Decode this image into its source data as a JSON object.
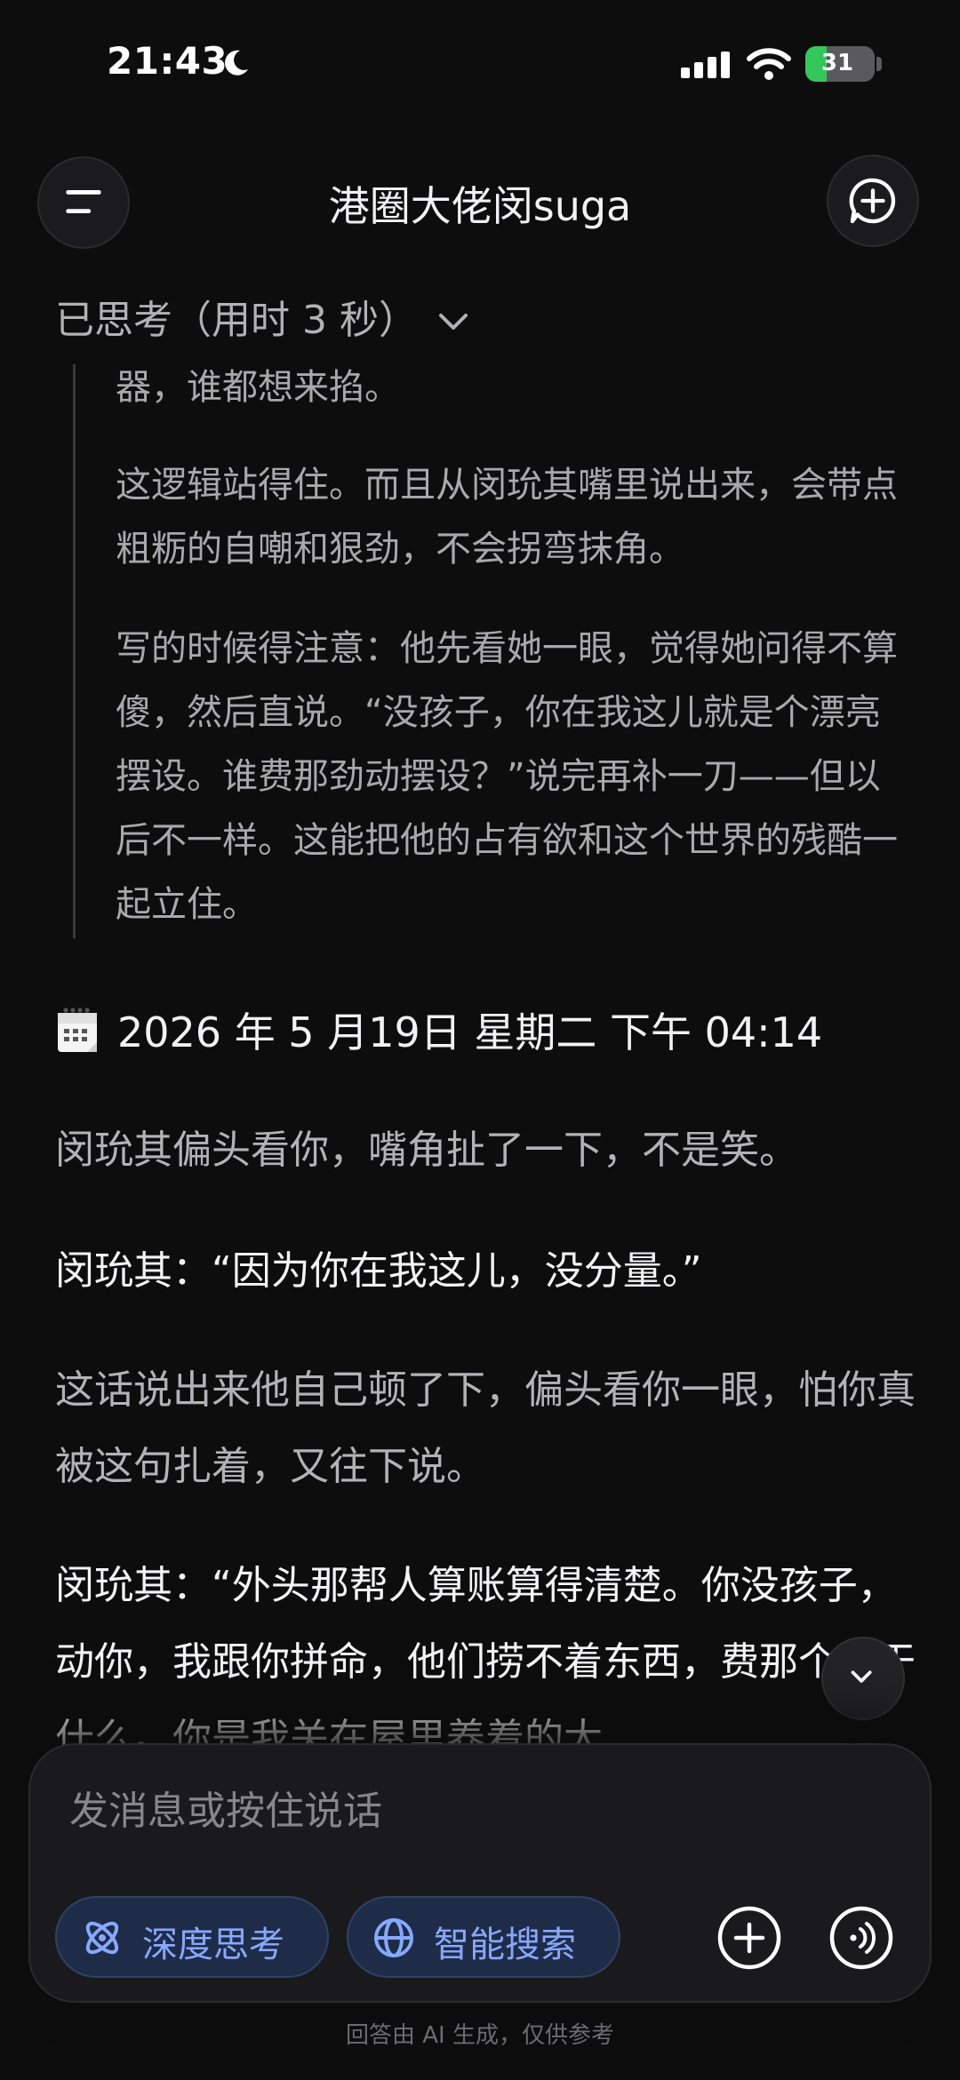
{
  "status_bar": {
    "time": "21:43",
    "battery": "31",
    "battery_level": 0.31
  },
  "header": {
    "title": "港圈大佬闵suga"
  },
  "thinking": {
    "toggle_label": "已思考（用时 3 秒）",
    "paragraphs": [
      "器，谁都想来掐。",
      "这逻辑站得住。而且从闵玧其嘴里说出来，会带点粗粝的自嘲和狠劲，不会拐弯抹角。",
      "写的时候得注意：他先看她一眼，觉得她问得不算傻，然后直说。“没孩子，你在我这儿就是个漂亮摆设。谁费那劲动摆设？”说完再补一刀——但以后不一样。这能把他的占有欲和这个世界的残酷一起立住。"
    ]
  },
  "date_line": "2026 年 5 月19日 星期二 下午 04:14",
  "messages": [
    "闵玧其偏头看你，嘴角扯了一下，不是笑。",
    "闵玧其：“因为你在我这儿，没分量。”",
    "这话说出来他自己顿了下，偏头看你一眼，怕你真被这句扎着，又往下说。",
    "闵玧其：“外头那帮人算账算得清楚。你没孩子，动你，我跟你拼命，他们捞不着东西，费那个劲干什么。你是我关在屋里养着的大"
  ],
  "composer": {
    "placeholder": "发消息或按住说话",
    "deep_think_label": "深度思考",
    "smart_search_label": "智能搜索"
  },
  "disclaimer": "回答由 AI 生成，仅供参考",
  "colors": {
    "accent": "#86a8ff",
    "background": "#0d0d0e",
    "battery_green": "#34c759"
  }
}
